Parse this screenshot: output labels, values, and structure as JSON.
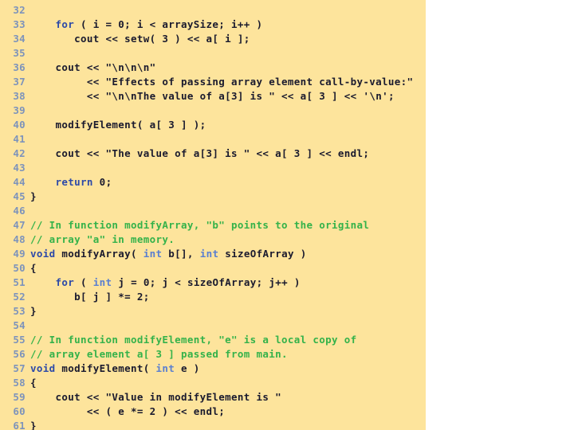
{
  "editor": {
    "background_color": "#fde49c",
    "page_background_color": "#ffffff",
    "lineno_color": "#7d93bb",
    "keyword_color": "#2c49a8",
    "type_color": "#5a7fd0",
    "comment_color": "#34b24a",
    "text_color": "#1a1a2e",
    "language": "C++",
    "first_line_number": 32,
    "last_line_number": 61
  },
  "lines": [
    {
      "n": "32",
      "tokens": []
    },
    {
      "n": "33",
      "tokens": [
        {
          "t": "plain",
          "s": "    "
        },
        {
          "t": "kw",
          "s": "for"
        },
        {
          "t": "plain",
          "s": " ( i = 0; i < arraySize; i++ )"
        }
      ]
    },
    {
      "n": "34",
      "tokens": [
        {
          "t": "plain",
          "s": "       cout << setw( 3 ) << a[ i ];"
        }
      ]
    },
    {
      "n": "35",
      "tokens": []
    },
    {
      "n": "36",
      "tokens": [
        {
          "t": "plain",
          "s": "    cout << "
        },
        {
          "t": "str",
          "s": "\"\\n\\n\\n\""
        }
      ]
    },
    {
      "n": "37",
      "tokens": [
        {
          "t": "plain",
          "s": "         << "
        },
        {
          "t": "str",
          "s": "\"Effects of passing array element call-by-value:\""
        }
      ]
    },
    {
      "n": "38",
      "tokens": [
        {
          "t": "plain",
          "s": "         << "
        },
        {
          "t": "str",
          "s": "\"\\n\\nThe value of a[3] is \""
        },
        {
          "t": "plain",
          "s": " << a[ 3 ] << "
        },
        {
          "t": "str",
          "s": "'\\n'"
        },
        {
          "t": "plain",
          "s": ";"
        }
      ]
    },
    {
      "n": "39",
      "tokens": []
    },
    {
      "n": "40",
      "tokens": [
        {
          "t": "plain",
          "s": "    modifyElement( a[ 3 ] );"
        }
      ]
    },
    {
      "n": "41",
      "tokens": []
    },
    {
      "n": "42",
      "tokens": [
        {
          "t": "plain",
          "s": "    cout << "
        },
        {
          "t": "str",
          "s": "\"The value of a[3] is \""
        },
        {
          "t": "plain",
          "s": " << a[ 3 ] << endl;"
        }
      ]
    },
    {
      "n": "43",
      "tokens": []
    },
    {
      "n": "44",
      "tokens": [
        {
          "t": "plain",
          "s": "    "
        },
        {
          "t": "kw",
          "s": "return"
        },
        {
          "t": "plain",
          "s": " "
        },
        {
          "t": "num",
          "s": "0"
        },
        {
          "t": "plain",
          "s": ";"
        }
      ]
    },
    {
      "n": "45",
      "tokens": [
        {
          "t": "plain",
          "s": "}"
        }
      ]
    },
    {
      "n": "46",
      "tokens": []
    },
    {
      "n": "47",
      "tokens": [
        {
          "t": "comment",
          "s": "// In function modifyArray, \"b\" points to the original"
        }
      ]
    },
    {
      "n": "48",
      "tokens": [
        {
          "t": "comment",
          "s": "// array \"a\" in memory."
        }
      ]
    },
    {
      "n": "49",
      "tokens": [
        {
          "t": "kw",
          "s": "void"
        },
        {
          "t": "plain",
          "s": " modifyArray( "
        },
        {
          "t": "type",
          "s": "int"
        },
        {
          "t": "plain",
          "s": " b[], "
        },
        {
          "t": "type",
          "s": "int"
        },
        {
          "t": "plain",
          "s": " sizeOfArray )"
        }
      ]
    },
    {
      "n": "50",
      "tokens": [
        {
          "t": "plain",
          "s": "{"
        }
      ]
    },
    {
      "n": "51",
      "tokens": [
        {
          "t": "plain",
          "s": "    "
        },
        {
          "t": "kw",
          "s": "for"
        },
        {
          "t": "plain",
          "s": " ( "
        },
        {
          "t": "type",
          "s": "int"
        },
        {
          "t": "plain",
          "s": " j = 0; j < sizeOfArray; j++ )"
        }
      ]
    },
    {
      "n": "52",
      "tokens": [
        {
          "t": "plain",
          "s": "       b[ j ] *= 2;"
        }
      ]
    },
    {
      "n": "53",
      "tokens": [
        {
          "t": "plain",
          "s": "}"
        }
      ]
    },
    {
      "n": "54",
      "tokens": []
    },
    {
      "n": "55",
      "tokens": [
        {
          "t": "comment",
          "s": "// In function modifyElement, \"e\" is a local copy of"
        }
      ]
    },
    {
      "n": "56",
      "tokens": [
        {
          "t": "comment",
          "s": "// array element a[ 3 ] passed from main."
        }
      ]
    },
    {
      "n": "57",
      "tokens": [
        {
          "t": "kw",
          "s": "void"
        },
        {
          "t": "plain",
          "s": " modifyElement( "
        },
        {
          "t": "type",
          "s": "int"
        },
        {
          "t": "plain",
          "s": " e )"
        }
      ]
    },
    {
      "n": "58",
      "tokens": [
        {
          "t": "plain",
          "s": "{"
        }
      ]
    },
    {
      "n": "59",
      "tokens": [
        {
          "t": "plain",
          "s": "    cout << "
        },
        {
          "t": "str",
          "s": "\"Value in modifyElement is \""
        }
      ]
    },
    {
      "n": "60",
      "tokens": [
        {
          "t": "plain",
          "s": "         << ( e *= 2 ) << endl;"
        }
      ]
    },
    {
      "n": "61",
      "tokens": [
        {
          "t": "plain",
          "s": "}"
        }
      ]
    }
  ]
}
